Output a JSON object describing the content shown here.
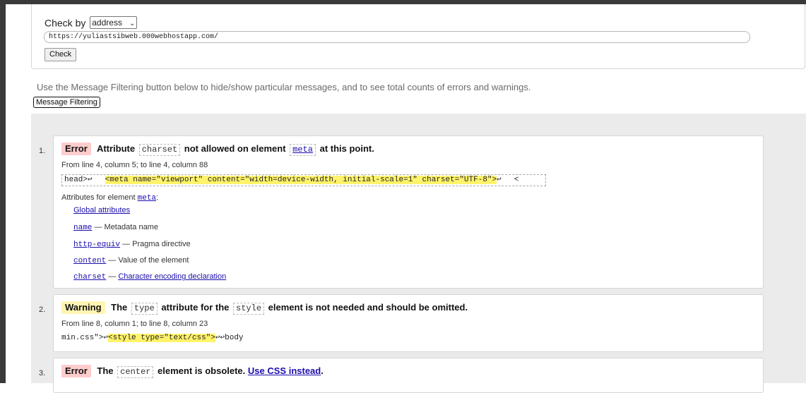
{
  "form": {
    "check_by_label": "Check by",
    "check_by_value": "address",
    "url_value": "https://yuliastsibweb.000webhostapp.com/",
    "check_button": "Check"
  },
  "info_text": "Use the Message Filtering button below to hide/show particular messages, and to see total counts of errors and warnings.",
  "filter_button": "Message Filtering",
  "messages": [
    {
      "number": "1.",
      "type": "Error",
      "text_1": "Attribute",
      "code_1": "charset",
      "text_2": "not allowed on element",
      "code_2": "meta",
      "text_3": "at this point.",
      "location": "From line 4, column 5; to line 4, column 88",
      "extract_pre": "head>↩",
      "extract_hl": "<meta name=\"viewport\" content=\"width=device-width, initial-scale=1\" charset=\"UTF-8\">",
      "extract_post": "↩",
      "extract_tail": "<",
      "attrs_label_pre": "Attributes for element",
      "attrs_label_elem": "meta",
      "attrs_label_post": ":",
      "attrs": [
        {
          "name": "",
          "desc": "Global attributes"
        },
        {
          "name": "name",
          "desc": "— Metadata name"
        },
        {
          "name": "http-equiv",
          "desc": "— Pragma directive"
        },
        {
          "name": "content",
          "desc": "— Value of the element"
        },
        {
          "name": "charset",
          "desc": "— ",
          "desc_link": "Character encoding declaration"
        }
      ]
    },
    {
      "number": "2.",
      "type": "Warning",
      "text_1": "The",
      "code_1": "type",
      "text_2": "attribute for the",
      "code_2": "style",
      "text_3": "element is not needed and should be omitted.",
      "location": "From line 8, column 1; to line 8, column 23",
      "extract_pre": "min.css\">↩",
      "extract_hl": "<style type=\"text/css\">",
      "extract_post": "↩↩body"
    },
    {
      "number": "3.",
      "type": "Error",
      "text_1": "The",
      "code_1": "center",
      "text_2": "element is obsolete.",
      "link": "Use CSS instead",
      "text_3": "."
    }
  ]
}
